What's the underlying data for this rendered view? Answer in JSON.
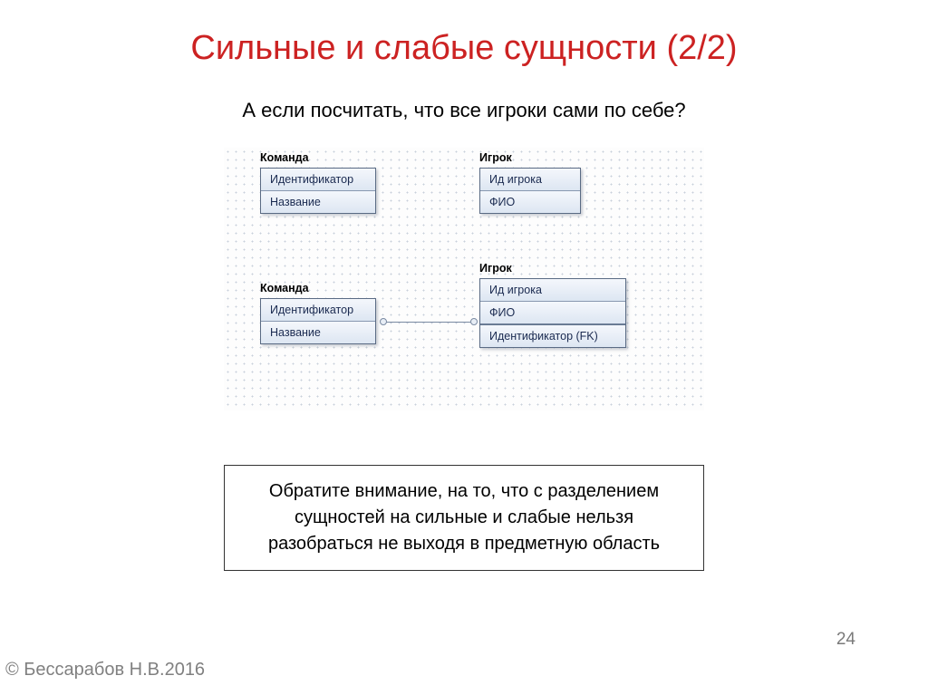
{
  "title": "Сильные и слабые сущности (2/2)",
  "subtitle": "А если посчитать, что все игроки сами по себе?",
  "diagram": {
    "top": {
      "team": {
        "label": "Команда",
        "rows": [
          "Идентификатор",
          "Название"
        ]
      },
      "player": {
        "label": "Игрок",
        "rows": [
          "Ид игрока",
          "ФИО"
        ]
      }
    },
    "bottom": {
      "team": {
        "label": "Команда",
        "rows": [
          "Идентификатор",
          "Название"
        ]
      },
      "player": {
        "label": "Игрок",
        "rows": [
          "Ид игрока",
          "ФИО",
          "Идентификатор (FK)"
        ]
      }
    }
  },
  "note": "Обратите внимание, на то, что с разделением сущностей на сильные и слабые нельзя разобраться не выходя в предметную область",
  "page_number": "24",
  "copyright": "© Бессарабов Н.В.2016"
}
